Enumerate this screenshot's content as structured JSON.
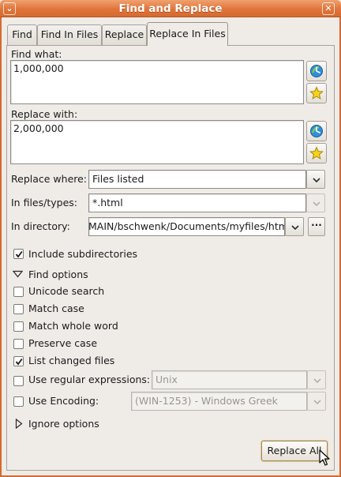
{
  "window": {
    "title": "Find and Replace",
    "menu_glyph": "⌄",
    "close_glyph": "✕"
  },
  "tabs": [
    {
      "label": "Find",
      "active": false
    },
    {
      "label": "Find In Files",
      "active": false
    },
    {
      "label": "Replace",
      "active": false
    },
    {
      "label": "Replace In Files",
      "active": true
    }
  ],
  "find": {
    "label": "Find what:",
    "value": "1,000,000"
  },
  "replace": {
    "label": "Replace with:",
    "value": "2,000,000"
  },
  "replace_where": {
    "label": "Replace where:",
    "value": "Files listed"
  },
  "file_types": {
    "label": "In files/types:",
    "value": "*.html"
  },
  "directory": {
    "label": "In directory:",
    "value": "MAIN/bschwenk/Documents/myfiles/html",
    "browse_label": "···"
  },
  "include_subdirectories": {
    "label": "Include subdirectories",
    "checked": true
  },
  "find_options": {
    "label": "Find options",
    "expanded": true
  },
  "options": [
    {
      "label": "Unicode search",
      "checked": false
    },
    {
      "label": "Match case",
      "checked": false
    },
    {
      "label": "Match whole word",
      "checked": false
    },
    {
      "label": "Preserve case",
      "checked": false
    },
    {
      "label": "List changed files",
      "checked": true
    }
  ],
  "regex": {
    "label": "Use regular expressions:",
    "checked": false,
    "value": "Unix"
  },
  "encoding": {
    "label": "Use Encoding:",
    "checked": false,
    "value": "(WIN-1253) - Windows Greek"
  },
  "ignore_options": {
    "label": "Ignore options",
    "expanded": false
  },
  "actions": {
    "replace_all": "Replace All"
  },
  "icons": {
    "history": "history-icon",
    "favorites": "star-icon",
    "chevron": "chevron-down-icon"
  }
}
